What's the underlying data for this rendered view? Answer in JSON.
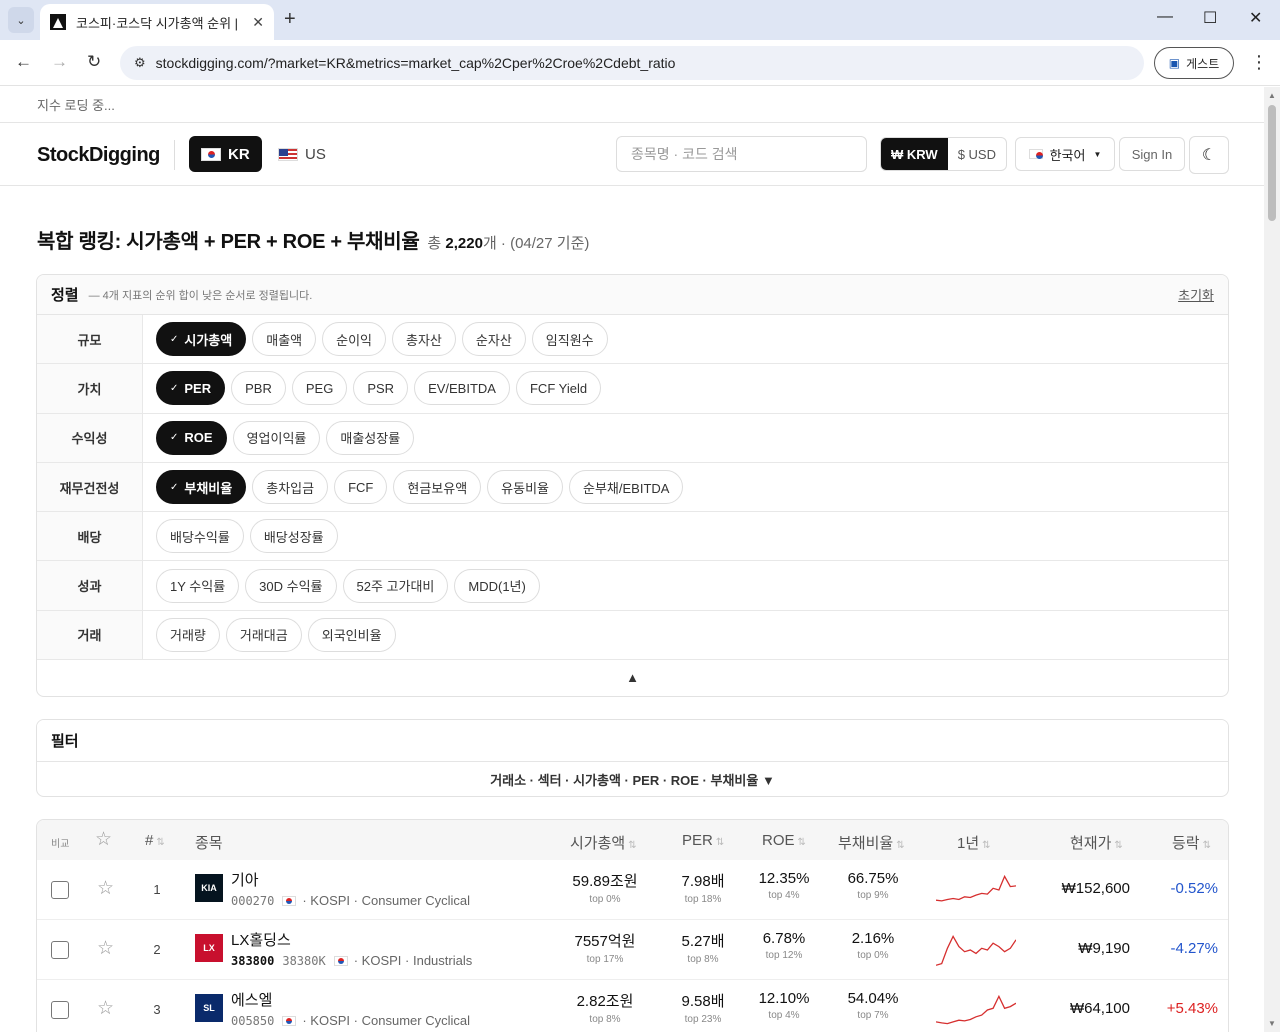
{
  "browser": {
    "tab_title": "코스피·코스닥 시가총액 순위 |",
    "url": "stockdigging.com/?market=KR&metrics=market_cap%2Cper%2Croe%2Cdebt_ratio",
    "profile_label": "게스트"
  },
  "ticker_text": "지수 로딩 중...",
  "header": {
    "logo": "StockDigging",
    "markets": [
      "KR",
      "US"
    ],
    "search_placeholder": "종목명 · 코드 검색",
    "currencies": [
      "₩ KRW",
      "$ USD"
    ],
    "language": "한국어",
    "sign_in": "Sign In"
  },
  "title": {
    "heading": "복합 랭킹: 시가총액 + PER + ROE + 부채비율",
    "total_prefix": "총",
    "total_count": "2,220",
    "total_suffix": "개 · (04/27 기준)"
  },
  "sort": {
    "title": "정렬",
    "hint": "— 4개 지표의 순위 합이 낮은 순서로 정렬됩니다.",
    "reset": "초기화",
    "groups": [
      {
        "label": "규모",
        "chips": [
          "시가총액",
          "매출액",
          "순이익",
          "총자산",
          "순자산",
          "임직원수"
        ],
        "selected": 0
      },
      {
        "label": "가치",
        "chips": [
          "PER",
          "PBR",
          "PEG",
          "PSR",
          "EV/EBITDA",
          "FCF Yield"
        ],
        "selected": 0
      },
      {
        "label": "수익성",
        "chips": [
          "ROE",
          "영업이익률",
          "매출성장률"
        ],
        "selected": 0
      },
      {
        "label": "재무건전성",
        "chips": [
          "부채비율",
          "총차입금",
          "FCF",
          "현금보유액",
          "유동비율",
          "순부채/EBITDA"
        ],
        "selected": 0
      },
      {
        "label": "배당",
        "chips": [
          "배당수익률",
          "배당성장률"
        ],
        "selected": -1
      },
      {
        "label": "성과",
        "chips": [
          "1Y 수익률",
          "30D 수익률",
          "52주 고가대비",
          "MDD(1년)"
        ],
        "selected": -1
      },
      {
        "label": "거래",
        "chips": [
          "거래량",
          "거래대금",
          "외국인비율"
        ],
        "selected": -1
      }
    ],
    "collapse_icon": "▲"
  },
  "filter": {
    "title": "필터",
    "summary": "거래소 · 섹터 · 시가총액 · PER · ROE · 부채비율 ▼"
  },
  "table": {
    "headers": {
      "compare": "비교",
      "rank": "#",
      "name": "종목",
      "market_cap": "시가총액",
      "per": "PER",
      "roe": "ROE",
      "debt": "부채비율",
      "year": "1년",
      "price": "현재가",
      "change": "등락"
    },
    "sort_icon": "⇅",
    "rows": [
      {
        "rank": "1",
        "name": "기아",
        "code": "000270",
        "code2": "",
        "market": "· KOSPI",
        "sector": "· Consumer Cyclical",
        "logo_text": "KIA",
        "logo_color": "#05141f",
        "market_cap": "59.89조원",
        "market_cap_pct": "top 0%",
        "per": "7.98배",
        "per_pct": "top 18%",
        "roe": "12.35%",
        "roe_pct": "top 4%",
        "debt": "66.75%",
        "debt_pct": "top 9%",
        "spark": [
          0.2,
          0.18,
          0.22,
          0.25,
          0.22,
          0.3,
          0.28,
          0.35,
          0.4,
          0.38,
          0.55,
          0.5,
          0.9,
          0.6,
          0.62
        ],
        "price": "₩152,600",
        "change": "-0.52%",
        "direction": "neg"
      },
      {
        "rank": "2",
        "name": "LX홀딩스",
        "code": "383800",
        "code2": "38380K",
        "market": "· KOSPI",
        "sector": "· Industrials",
        "logo_text": "LX",
        "logo_color": "#c8102e",
        "market_cap": "7557억원",
        "market_cap_pct": "top 17%",
        "per": "5.27배",
        "per_pct": "top 8%",
        "roe": "6.78%",
        "roe_pct": "top 12%",
        "debt": "2.16%",
        "debt_pct": "top 0%",
        "spark": [
          0.05,
          0.1,
          0.55,
          0.9,
          0.6,
          0.45,
          0.5,
          0.4,
          0.55,
          0.5,
          0.7,
          0.6,
          0.45,
          0.55,
          0.8
        ],
        "price": "₩9,190",
        "change": "-4.27%",
        "direction": "neg"
      },
      {
        "rank": "3",
        "name": "에스엘",
        "code": "005850",
        "code2": "",
        "market": "· KOSPI",
        "sector": "· Consumer Cyclical",
        "logo_text": "SL",
        "logo_color": "#0a2a6b",
        "market_cap": "2.82조원",
        "market_cap_pct": "top 8%",
        "per": "9.58배",
        "per_pct": "top 23%",
        "roe": "12.10%",
        "roe_pct": "top 4%",
        "debt": "54.04%",
        "debt_pct": "top 7%",
        "spark": [
          0.15,
          0.12,
          0.1,
          0.15,
          0.2,
          0.18,
          0.22,
          0.3,
          0.35,
          0.5,
          0.55,
          0.9,
          0.55,
          0.6,
          0.7
        ],
        "price": "₩64,100",
        "change": "+5.43%",
        "direction": "pos"
      }
    ],
    "spark_color": "#d62f2f"
  }
}
